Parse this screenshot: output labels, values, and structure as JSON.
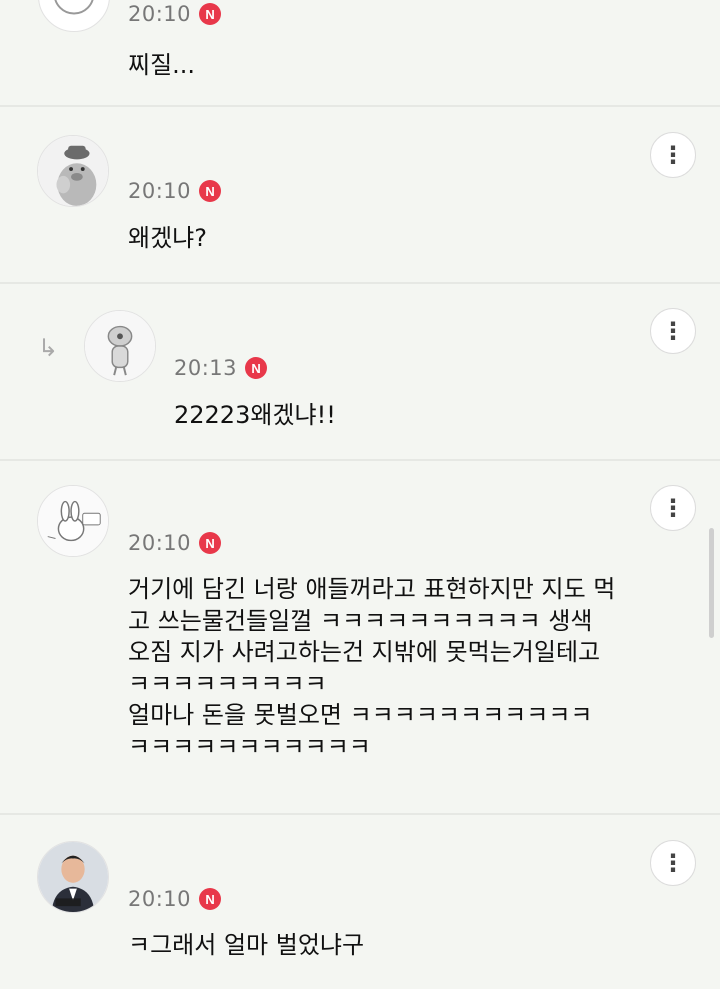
{
  "comments": [
    {
      "time": "20:10",
      "badge": "N",
      "text": "찌질..."
    },
    {
      "time": "20:10",
      "badge": "N",
      "text": "왜겠냐?",
      "menu_icon": "more-vertical-icon"
    },
    {
      "time": "20:13",
      "badge": "N",
      "text": "22223왜겠냐!!",
      "menu_icon": "more-vertical-icon",
      "reply_icon": "reply-arrow-icon"
    },
    {
      "time": "20:10",
      "badge": "N",
      "text": "거기에 담긴 너랑 애들꺼라고 표현하지만 지도 먹\n고 쓰는물건들일껄 ㅋㅋㅋㅋㅋㅋㅋㅋㅋㅋ 생색\n오짐 지가 사려고하는건 지밖에 못먹는거일테고\nㅋㅋㅋㅋㅋㅋㅋㅋㅋ\n얼마나 돈을 못벌오면 ㅋㅋㅋㅋㅋㅋㅋㅋㅋㅋㅋ\nㅋㅋㅋㅋㅋㅋㅋㅋㅋㅋㅋ",
      "menu_icon": "more-vertical-icon"
    },
    {
      "time": "20:10",
      "badge": "N",
      "text": "ㅋ그래서 얼마 벌었냐구",
      "menu_icon": "more-vertical-icon"
    }
  ],
  "colors": {
    "badge": "#e8384a",
    "background": "#f4f6f2",
    "divider": "#e6e8e4"
  }
}
